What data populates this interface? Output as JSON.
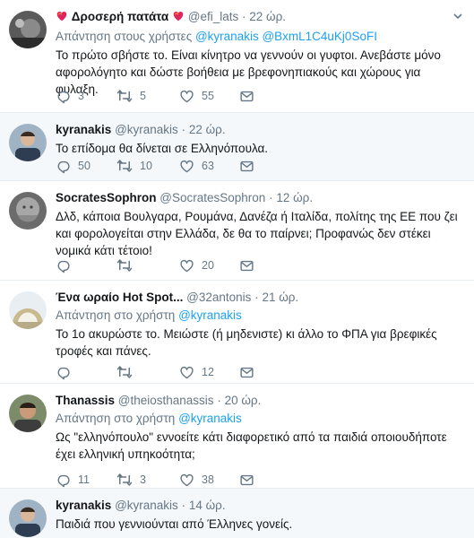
{
  "tweets": [
    {
      "name": "Δροσερή πατάτα",
      "handle": "@efi_lats",
      "dot": "·",
      "time": "22 ώρ.",
      "reply_prefix": "Απάντηση στους χρήστες",
      "reply_to": "@kyranakis @BxmL1C4uKj0SoFI",
      "text": "Το πρώτο σβήστε το. Είναι κίνητρο να γεννούν οι γυφτοι. Ανεβάστε μόνο αφορολόγητο και δώστε βοήθεια με βρεφονηπιακούς και χώρους για φυλαξη.",
      "replies": "3",
      "retweets": "5",
      "likes": "55"
    },
    {
      "name": "kyranakis",
      "handle": "@kyranakis",
      "dot": "·",
      "time": "22 ώρ.",
      "text": "Το επίδομα θα δίνεται σε Ελληνόπουλα.",
      "replies": "50",
      "retweets": "10",
      "likes": "63"
    },
    {
      "name": "SocratesSophron",
      "handle": "@SocratesSophron",
      "dot": "·",
      "time": "12 ώρ.",
      "text": "Δλδ, κάποια Βουλγαρα, Ρουμάνα, Δανέζα ή Ιταλίδα, πολίτης της ΕΕ που ζει και φορολογείται στην Ελλάδα, δε θα το παίρνει; Προφανώς δεν στέκει νομικά κάτι τέτοιο!",
      "replies": "",
      "retweets": "",
      "likes": "20"
    },
    {
      "name": "Ένα ωραίο Hot Spot...",
      "handle": "@32antonis",
      "dot": "·",
      "time": "21 ώρ.",
      "reply_prefix": "Απάντηση στο χρήστη",
      "reply_to": "@kyranakis",
      "text": "Το 1ο ακυρώστε το. Μειώστε (ή μηδενιστε) κι άλλο το ΦΠΑ για βρεφικές τροφές και πάνες.",
      "replies": "",
      "retweets": "",
      "likes": "12"
    },
    {
      "name": "Thanassis",
      "handle": "@theiosthanassis",
      "dot": "·",
      "time": "20 ώρ.",
      "reply_prefix": "Απάντηση στο χρήστη",
      "reply_to": "@kyranakis",
      "text": "Ως \"ελληνόπουλο\" εννοείτε κάτι διαφορετικό από τα παιδιά οποιουδήποτε έχει ελληνική υπηκοότητα;",
      "replies": "11",
      "retweets": "3",
      "likes": "38"
    },
    {
      "name": "kyranakis",
      "handle": "@kyranakis",
      "dot": "·",
      "time": "14 ώρ.",
      "text": "Παιδιά που γεννιούνται από Έλληνες γονείς."
    }
  ],
  "colors": {
    "accent": "#1da1f2",
    "muted": "#657786",
    "highlight_bg": "#f5f8fa",
    "divider": "#e6ecf0"
  },
  "icons": [
    "reply-icon",
    "retweet-icon",
    "like-icon",
    "direct-message-icon",
    "chevron-down-icon",
    "heart-emoji-icon"
  ]
}
